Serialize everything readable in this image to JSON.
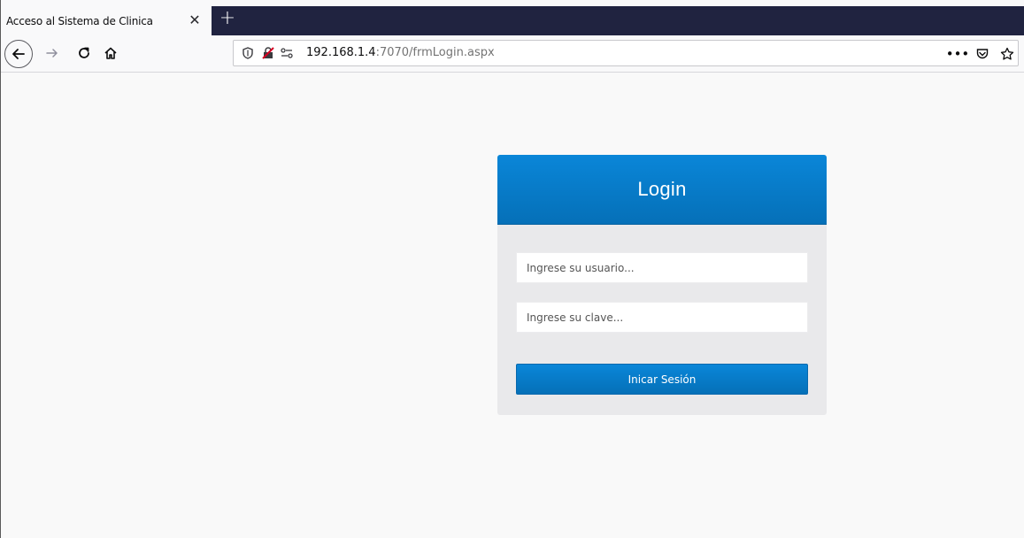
{
  "browser": {
    "tab": {
      "title": "Acceso al Sistema de Clinica"
    },
    "url": {
      "host": "192.168.1.4",
      "rest": ":7070/frmLogin.aspx"
    }
  },
  "login": {
    "title": "Login",
    "username_placeholder": "Ingrese su usuario...",
    "password_placeholder": "Ingrese su clave...",
    "submit_label": "Inicar Sesión"
  },
  "colors": {
    "tabstrip": "#202340",
    "login_blue": "#0a86d8",
    "card_bg": "#e9e9eb"
  }
}
